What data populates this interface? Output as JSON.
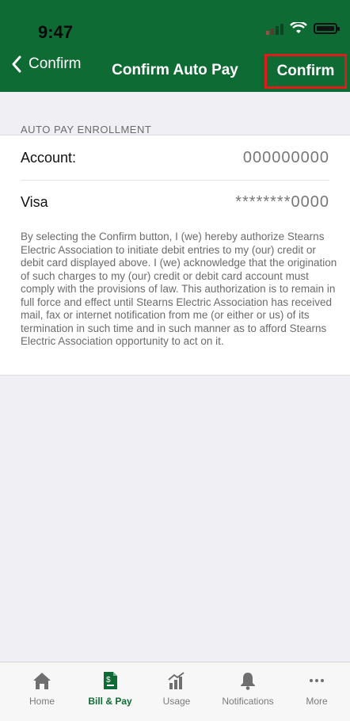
{
  "status_bar": {
    "time": "9:47"
  },
  "nav": {
    "back_label": "Confirm",
    "title": "Confirm Auto Pay",
    "confirm_label": "Confirm"
  },
  "section": {
    "title": "AUTO PAY ENROLLMENT"
  },
  "account": {
    "label": "Account:",
    "value": "000000000"
  },
  "card": {
    "label": "Visa",
    "value": "********0000"
  },
  "disclaimer": "By selecting the Confirm button, I (we) hereby authorize Stearns Electric Association to initiate debit entries to my (our) credit or debit card displayed above. I (we) acknowledge that the origination of such charges to my (our) credit or debit card account must comply with the provisions of law. This authorization is to remain in full force and effect until Stearns Electric Association has received mail, fax or internet notification from me (or either or us) of its termination in such time and in such manner as to afford Stearns Electric Association opportunity to act on it.",
  "tabs": [
    {
      "label": "Home",
      "icon": "home-icon"
    },
    {
      "label": "Bill & Pay",
      "icon": "bill-icon",
      "active": true
    },
    {
      "label": "Usage",
      "icon": "usage-icon"
    },
    {
      "label": "Notifications",
      "icon": "bell-icon"
    },
    {
      "label": "More",
      "icon": "more-icon"
    }
  ],
  "colors": {
    "brand": "#0f6b34",
    "highlight": "#e01b1b"
  }
}
